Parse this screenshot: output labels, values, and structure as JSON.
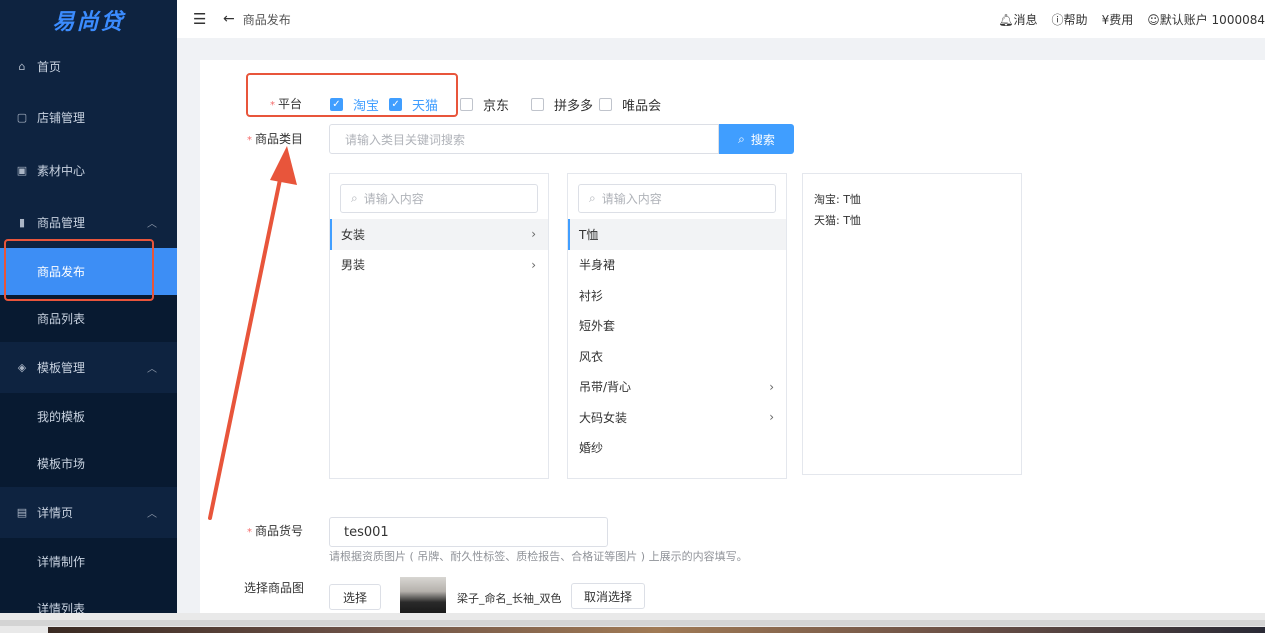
{
  "brand": "易尚贷",
  "topbar": {
    "crumb": "商品发布",
    "links": [
      "消息",
      "帮助",
      "费用",
      "默认账户 1000084"
    ]
  },
  "sidebar": {
    "home": "首页",
    "shop": "店铺管理",
    "material": "素材中心",
    "product": "商品管理",
    "product_publish": "商品发布",
    "product_list": "商品列表",
    "template": "模板管理",
    "my_template": "我的模板",
    "template_market": "模板市场",
    "detail": "详情页",
    "detail_make": "详情制作",
    "detail_list": "详情列表"
  },
  "form": {
    "platform_label": "平台",
    "platforms": [
      {
        "name": "淘宝",
        "checked": true
      },
      {
        "name": "天猫",
        "checked": true
      },
      {
        "name": "京东",
        "checked": false
      },
      {
        "name": "拼多多",
        "checked": false
      },
      {
        "name": "唯品会",
        "checked": false
      }
    ],
    "category_label": "商品类目",
    "category_placeholder": "请输入类目关键词搜索",
    "search_button": "搜索",
    "filter_placeholder": "请输入内容",
    "level1": [
      {
        "name": "女装",
        "has_children": true,
        "selected": true
      },
      {
        "name": "男装",
        "has_children": true,
        "selected": false
      }
    ],
    "level2": [
      {
        "name": "T恤",
        "has_children": false,
        "selected": true
      },
      {
        "name": "半身裙",
        "has_children": false,
        "selected": false
      },
      {
        "name": "衬衫",
        "has_children": false,
        "selected": false
      },
      {
        "name": "短外套",
        "has_children": false,
        "selected": false
      },
      {
        "name": "风衣",
        "has_children": false,
        "selected": false
      },
      {
        "name": "吊带/背心",
        "has_children": true,
        "selected": false
      },
      {
        "name": "大码女装",
        "has_children": true,
        "selected": false
      },
      {
        "name": "婚纱",
        "has_children": false,
        "selected": false
      }
    ],
    "summary": [
      "淘宝: T恤",
      "天猫: T恤"
    ],
    "sku_label": "商品货号",
    "sku_value": "tes001",
    "sku_hint": "请根据资质图片 ( 吊牌、耐久性标签、质检报告、合格证等图片 ) 上展示的内容填写。",
    "image_label": "选择商品图",
    "choose_button": "选择",
    "image_name": "梁子_命名_长袖_双色",
    "cancel_button": "取消选择"
  }
}
